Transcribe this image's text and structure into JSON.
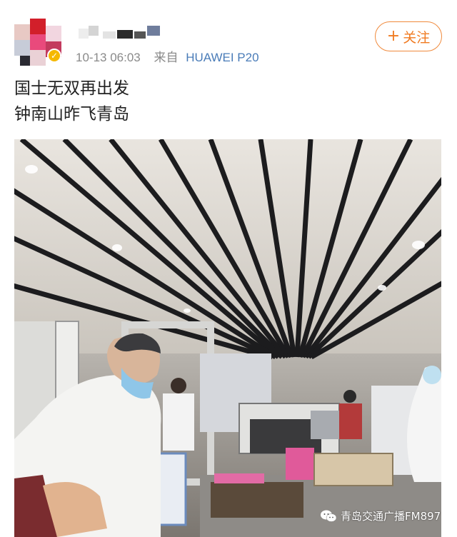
{
  "post": {
    "time": "10-13 06:03",
    "source_prefix": "来自",
    "device": "HUAWEI P20",
    "follow_label": "关注",
    "follow_plus": "+",
    "text_line1": "国士无双再出发",
    "text_line2": "钟南山昨飞青岛"
  },
  "photo": {
    "watermark": "青岛交通广播FM897"
  },
  "icons": {
    "avatar": "pixelated-avatar",
    "verified": "verified-badge-icon",
    "watermark": "wechat-icon"
  },
  "colors": {
    "follow": "#f07a20",
    "device_link": "#4a7cb8",
    "meta_text": "#8a8a8a",
    "verified": "#f5b800"
  }
}
